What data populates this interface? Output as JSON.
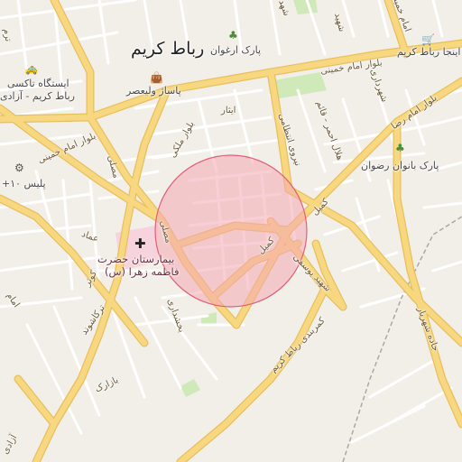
{
  "map": {
    "city_label": "رباط کریم",
    "highlight_circle": {
      "fill": "#f4a7b3",
      "stroke": "#e0607a",
      "opacity": 0.55
    },
    "colors": {
      "background": "#f2efe9",
      "major_road": "#f7d77f",
      "major_road_casing": "#e8bf5e",
      "minor_road": "#ffffff",
      "park": "#cfe9b8",
      "hospital_area": "#f7d3dd",
      "railway": "#a9a9a9"
    },
    "roads": {
      "imam_khomeini_blvd_north": "بلوار امام خمینی",
      "imam_khomeini_blvd_west": "بلوار امام خمینی",
      "imam_reza_blvd": "بلوار امام رضا",
      "shahrdari": "شهرداری",
      "shahid_tamr": "شهید",
      "malaki_blvd": "بلوار ملکی",
      "isar": "ایثار",
      "hilal_ahmar_qaem": "هلال احمر - قائم",
      "niroo_entezami": "نیروی انتظامی",
      "kamil": "کمیل",
      "kamil_2": "کمیل",
      "mosalla": "مصلی",
      "mosalla_2": "مصلی",
      "emad": "عماد",
      "kowsar": "کوثر",
      "imam": "امام",
      "tarkashdooz": "ترکاشوند",
      "bakhshdari": "بخشداری",
      "bazarak": "بازارک",
      "shahid_yousefi": "شهید یوسفی",
      "robat_karim_beltway": "کمربندی رباط کریم",
      "shahriar_road": "جاده شهریار",
      "imam_khomeini_top": "امام خمینی",
      "shahid_hasan": "شهد",
      "shahid_left": "ترم",
      "blvd_azadi": "آزادی"
    },
    "pois": {
      "park_arghavan": {
        "label": "پارک ارغوان",
        "icon": "tree-icon"
      },
      "bazar_valiasr": {
        "label": "پاساژ ولیعصر",
        "icon": "shopping-bag-icon"
      },
      "inja_robat_karim": {
        "label": "اینجا رباط کریم",
        "icon": "shopping-cart-icon"
      },
      "taxi_station": {
        "label": "ایستگاه تاکسی",
        "label2": "رباط کریم - آزادی",
        "icon": "taxi-icon"
      },
      "police": {
        "label": "پلیس ۱۰+",
        "icon": "police-icon"
      },
      "park_banovan": {
        "label": "پارک بانوان رضوان",
        "icon": "tree-icon"
      },
      "hospital": {
        "line1": "بیمارستان حضرت",
        "line2": "فاطمه زهرا (س)",
        "icon": "hospital-cross-icon"
      }
    }
  }
}
